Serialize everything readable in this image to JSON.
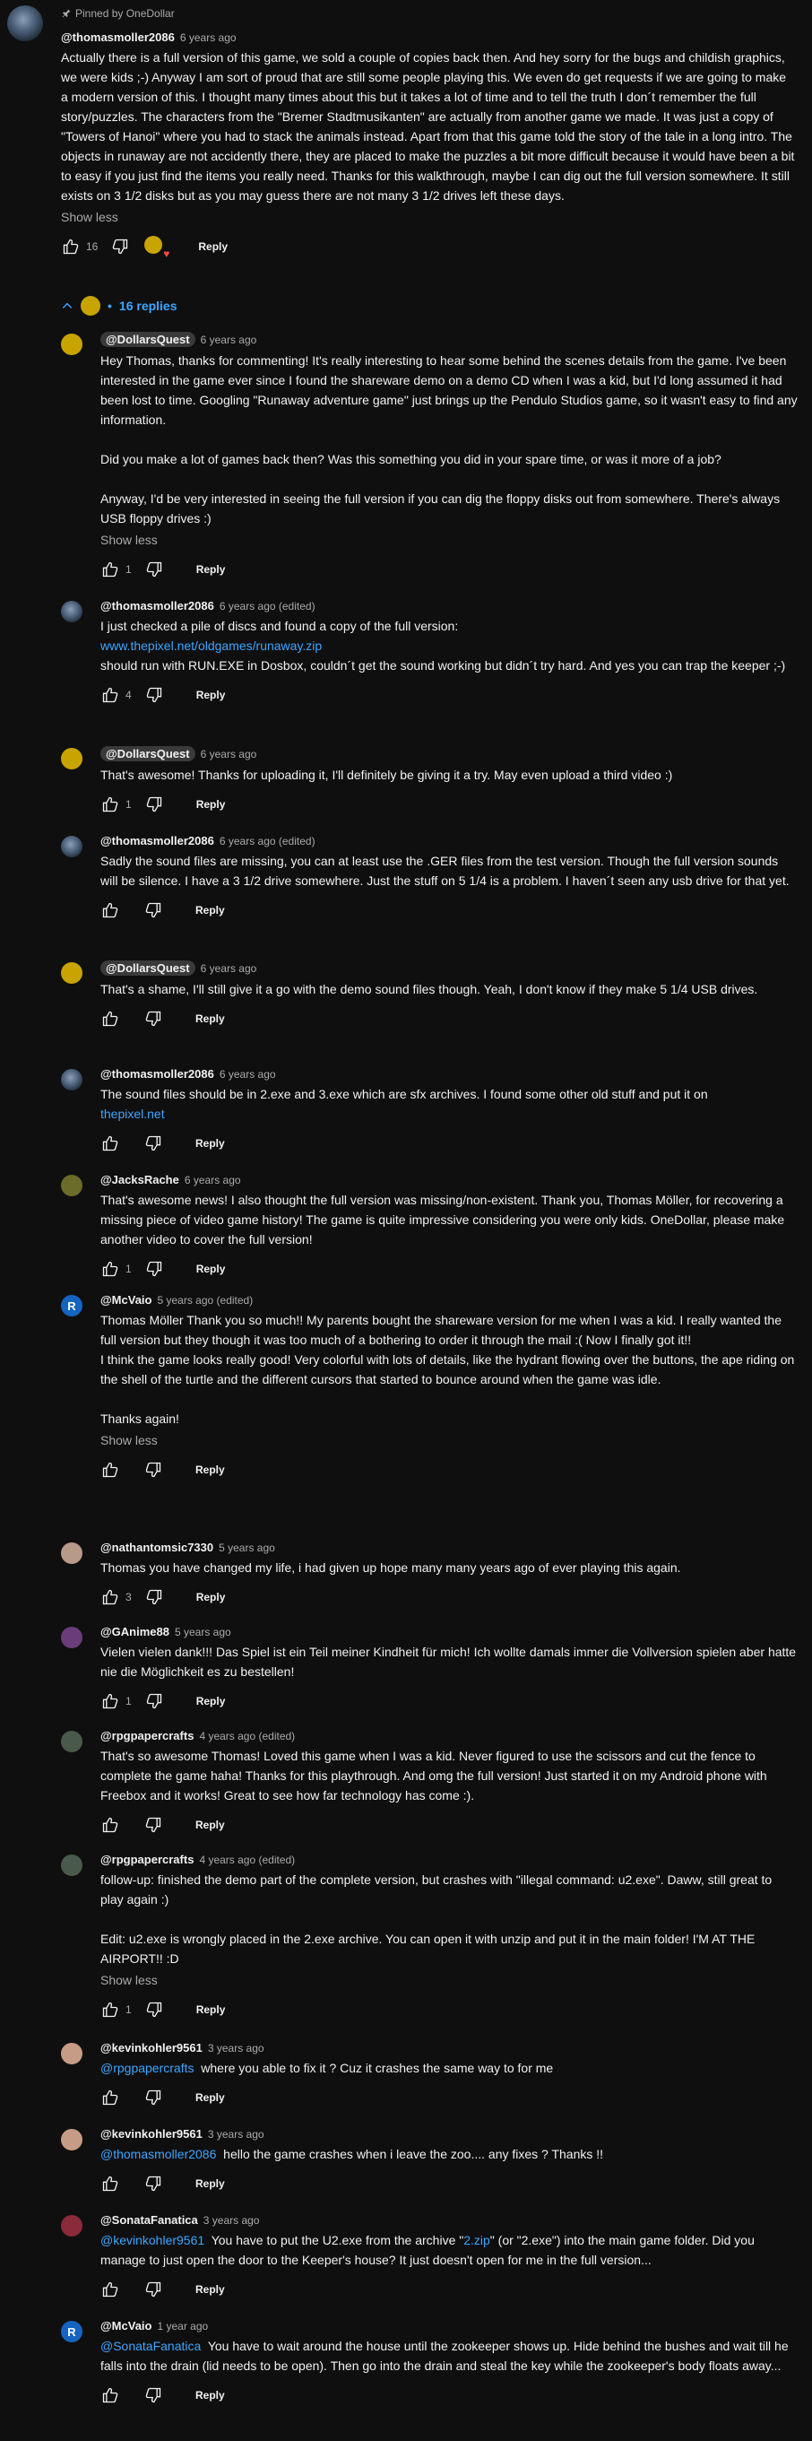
{
  "pinned": {
    "label": "Pinned by OneDollar"
  },
  "root": {
    "author": "@thomasmoller2086",
    "time": "6 years ago",
    "text": "Actually there is a full version of this game, we sold a couple of copies back then. And hey sorry for the bugs and childish graphics, we were kids ;-) Anyway I am sort of proud that are still some people playing this. We even do get requests if we are going to make a modern version of this. I thought many times about this but it takes a lot of time and to tell the truth I don´t remember the full story/puzzles. The characters from the \"Bremer Stadtmusikanten\" are actually from another game we made. It was just a copy of \"Towers of Hanoi\" where you had to stack the animals instead. Apart from that this game told the story of the tale in a long intro. The objects in runaway are not accidently there, they are placed to make the puzzles a bit more difficult because it would have been a bit to easy if you just find the items you really need. Thanks for this walkthrough, maybe I can dig out the full version somewhere. It still exists on 3 1/2 disks but as you may guess there are not many 3 1/2 drives left these days.",
    "show_less": "Show less",
    "likes": "16",
    "reply_label": "Reply",
    "replies_label": "16 replies"
  },
  "replies": [
    {
      "author": "@DollarsQuest",
      "time": "6 years ago",
      "text": "Hey Thomas, thanks for commenting! It's really interesting to hear some behind the scenes details from the game. I've been interested in the game ever since I found the shareware demo on a demo CD when I was a kid, but I'd long assumed it had been lost to time. Googling \"Runaway adventure game\" just brings up the Pendulo Studios game, so it wasn't easy to find any information.\n\nDid you make a lot of games back then? Was this something you did in your spare time, or was it more of a job?\n\nAnyway, I'd be very interested in seeing the full version if you can dig the floppy disks out from somewhere. There's always USB floppy drives :)",
      "show_less": "Show less",
      "likes": "1",
      "reply_label": "Reply"
    },
    {
      "author": "@thomasmoller2086",
      "time": "6 years ago (edited)",
      "text_before": "I just checked a pile of discs and found a copy of the full version:",
      "link": "www.thepixel.net/oldgames/runaway.zip",
      "text_after": "should run with RUN.EXE in Dosbox, couldn´t get the sound working but didn´t try hard. And yes you can trap the keeper ;-)",
      "likes": "4",
      "reply_label": "Reply"
    },
    {
      "author": "@DollarsQuest",
      "time": "6 years ago",
      "text": "That's awesome! Thanks for uploading it, I'll definitely be giving it a try. May even upload a third video :)",
      "likes": "1",
      "reply_label": "Reply"
    },
    {
      "author": "@thomasmoller2086",
      "time": "6 years ago (edited)",
      "text": "Sadly the sound files are missing, you can at least use the .GER files from the test version. Though the full version sounds will be silence. I have a 3 1/2 drive somewhere. Just the stuff on 5 1/4 is a problem. I haven´t seen any usb drive for that yet.",
      "likes": "",
      "reply_label": "Reply"
    },
    {
      "author": "@DollarsQuest",
      "time": "6 years ago",
      "text": "That's a shame, I'll still give it a go with the demo sound files though. Yeah, I don't know if they make 5 1/4 USB drives.",
      "likes": "",
      "reply_label": "Reply"
    },
    {
      "author": "@thomasmoller2086",
      "time": "6 years ago",
      "text_before": "The sound files should be in 2.exe and 3.exe which are sfx archives. I found some other old stuff and put it on",
      "link": "thepixel.net",
      "likes": "",
      "reply_label": "Reply"
    },
    {
      "author": "@JacksRache",
      "time": "6 years ago",
      "text": "That's awesome news! I also thought the full version was missing/non-existent. Thank you, Thomas Möller, for recovering a missing piece of video game history! The game is quite impressive considering you were only kids. OneDollar, please make another video to cover the full version!",
      "likes": "1",
      "reply_label": "Reply"
    },
    {
      "author": "@McVaio",
      "avatar_letter": "R",
      "time": "5 years ago (edited)",
      "text": "Thomas Möller Thank you so much!! My parents bought the shareware version for me when I was a kid. I really wanted the full version but they though it was too much of a bothering to order it through the mail :( Now I finally got it!!\nI think the game looks really good! Very colorful with lots of details, like the hydrant flowing over the buttons, the ape riding on the shell of the turtle and the different cursors that started to bounce around when the game was idle.\n\nThanks again!",
      "show_less": "Show less",
      "likes": "",
      "reply_label": "Reply"
    },
    {
      "author": "@nathantomsic7330",
      "time": "5 years ago",
      "text": "Thomas you have changed my life, i had given up hope many many years ago of ever playing this again.",
      "likes": "3",
      "reply_label": "Reply"
    },
    {
      "author": "@GAnime88",
      "time": "5 years ago",
      "text": "Vielen vielen dank!!! Das Spiel ist ein Teil meiner Kindheit für mich! Ich wollte damals immer die Vollversion spielen aber hatte nie die Möglichkeit es zu bestellen!",
      "likes": "1",
      "reply_label": "Reply"
    },
    {
      "author": "@rpgpapercrafts",
      "time": "4 years ago (edited)",
      "text": "That's so awesome Thomas! Loved this game when I was a kid. Never figured to use the scissors and cut the fence to complete the game haha! Thanks for this playthrough. And omg the full version! Just started it on my Android phone with Freebox and it works! Great to see how far technology has come :).",
      "likes": "",
      "reply_label": "Reply"
    },
    {
      "author": "@rpgpapercrafts",
      "time": "4 years ago (edited)",
      "text": "follow-up: finished the demo part of the complete version, but crashes with \"illegal command: u2.exe\". Daww, still great to play again :)\n\nEdit: u2.exe is wrongly placed in the 2.exe archive. You can open it with unzip and put it in the main folder! I'M AT THE AIRPORT!! :D",
      "show_less": "Show less",
      "likes": "1",
      "reply_label": "Reply"
    },
    {
      "author": "@kevinkohler9561",
      "time": "3 years ago",
      "mention": "@rpgpapercrafts",
      "text": "where you able to fix it ? Cuz it crashes the same way to for me",
      "likes": "",
      "reply_label": "Reply"
    },
    {
      "author": "@kevinkohler9561",
      "time": "3 years ago",
      "mention": "@thomasmoller2086",
      "text": "hello the game crashes when i leave the zoo.... any fixes ? Thanks !!",
      "likes": "",
      "reply_label": "Reply"
    },
    {
      "author": "@SonataFanatica",
      "time": "3 years ago",
      "mention": "@kevinkohler9561",
      "text_a": "You have to put the U2.exe from the archive \"",
      "link": "2.zip",
      "text_b": "\" (or \"2.exe\") into the main game folder. Did you manage to just open the door to the Keeper's house? It just doesn't open for me in the full version...",
      "likes": "",
      "reply_label": "Reply"
    },
    {
      "author": "@McVaio",
      "avatar_letter": "R",
      "time": "1 year ago",
      "mention": "@SonataFanatica",
      "text": "You have to wait around the house until the zookeeper shows up. Hide behind the bushes and wait till he falls into the drain (lid needs to be open). Then go into the drain and steal the key while the zookeeper's body floats away...",
      "likes": "",
      "reply_label": "Reply"
    }
  ]
}
